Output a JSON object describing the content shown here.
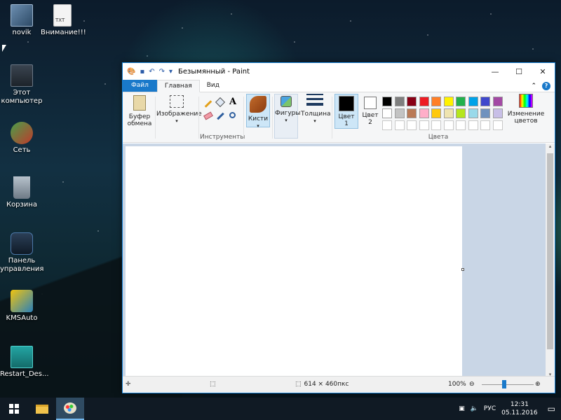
{
  "desktop": {
    "icons": [
      {
        "label": "novik"
      },
      {
        "label": "Внимание!!!",
        "badge": "TXT"
      },
      {
        "label": "Этот компьютер"
      },
      {
        "label": "Сеть"
      },
      {
        "label": "Корзина"
      },
      {
        "label": "Панель управления"
      },
      {
        "label": "KMSAuto"
      },
      {
        "label": "Restart_Des..."
      }
    ]
  },
  "window": {
    "title": "Безымянный - Paint",
    "controls": {
      "minimize": "—",
      "maximize": "☐",
      "close": "✕"
    },
    "tabs": [
      {
        "label": "Файл"
      },
      {
        "label": "Главная"
      },
      {
        "label": "Вид"
      }
    ],
    "ribbon": {
      "clipboard": "Буфер обмена",
      "image": "Изображение",
      "tools_label": "Инструменты",
      "brushes": "Кисти",
      "shapes": "Фигуры",
      "size": "Толщина",
      "color1_line1": "Цвет",
      "color1_line2": "1",
      "color2_line1": "Цвет",
      "color2_line2": "2",
      "edit_colors_line1": "Изменение",
      "edit_colors_line2": "цветов",
      "colors_label": "Цвета",
      "text_tool": "A"
    },
    "palette": {
      "row1": [
        "#000000",
        "#7f7f7f",
        "#880015",
        "#ed1c24",
        "#ff7f27",
        "#fff200",
        "#22b14c",
        "#00a2e8",
        "#3f48cc",
        "#a349a4"
      ],
      "row2": [
        "#ffffff",
        "#c3c3c3",
        "#b97a57",
        "#ffaec9",
        "#ffc90e",
        "#efe4b0",
        "#b5e61d",
        "#99d9ea",
        "#7092be",
        "#c8bfe7"
      ]
    },
    "status": {
      "dimensions": "614 × 460пкс",
      "zoom": "100%"
    }
  },
  "taskbar": {
    "lang": "РУС",
    "time": "12:31",
    "date": "05.11.2016"
  },
  "colors": {
    "accent": "#1979ca",
    "taskbar": "#101a24"
  }
}
